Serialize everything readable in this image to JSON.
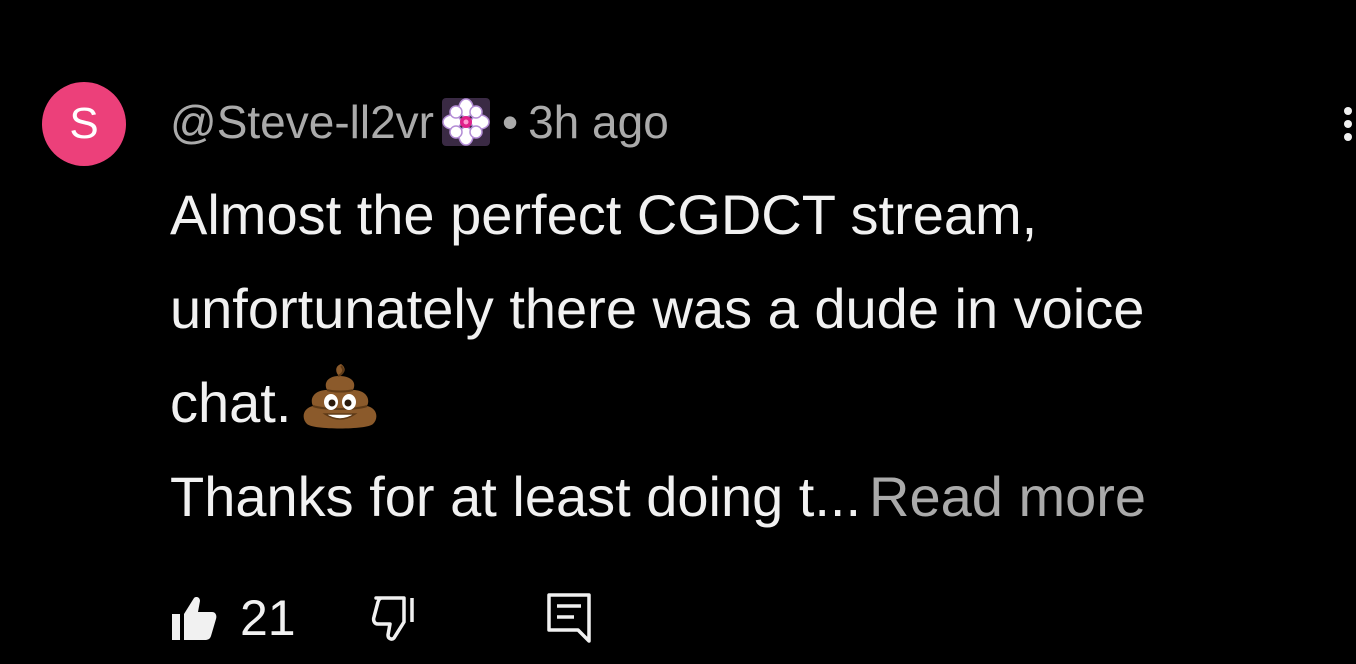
{
  "comment": {
    "avatar_letter": "S",
    "author": "@Steve-ll2vr",
    "separator": "•",
    "timestamp": "3h ago",
    "text_lines": [
      "Almost the perfect CGDCT stream,",
      "unfortunately there was a dude in voice",
      "chat.",
      "Thanks for at least doing t..."
    ],
    "read_more": "Read more",
    "likes": "21",
    "colors": {
      "avatar_bg": "#ec407a",
      "background": "#000000",
      "text_primary": "#f1f1f1",
      "text_secondary": "#aaaaaa"
    },
    "icons": {
      "badge": "member-badge-icon",
      "emoji": "pile-of-poo-emoji",
      "like": "thumbs-up-icon",
      "dislike": "thumbs-down-icon",
      "reply": "reply-icon",
      "menu": "more-vertical-icon"
    }
  }
}
